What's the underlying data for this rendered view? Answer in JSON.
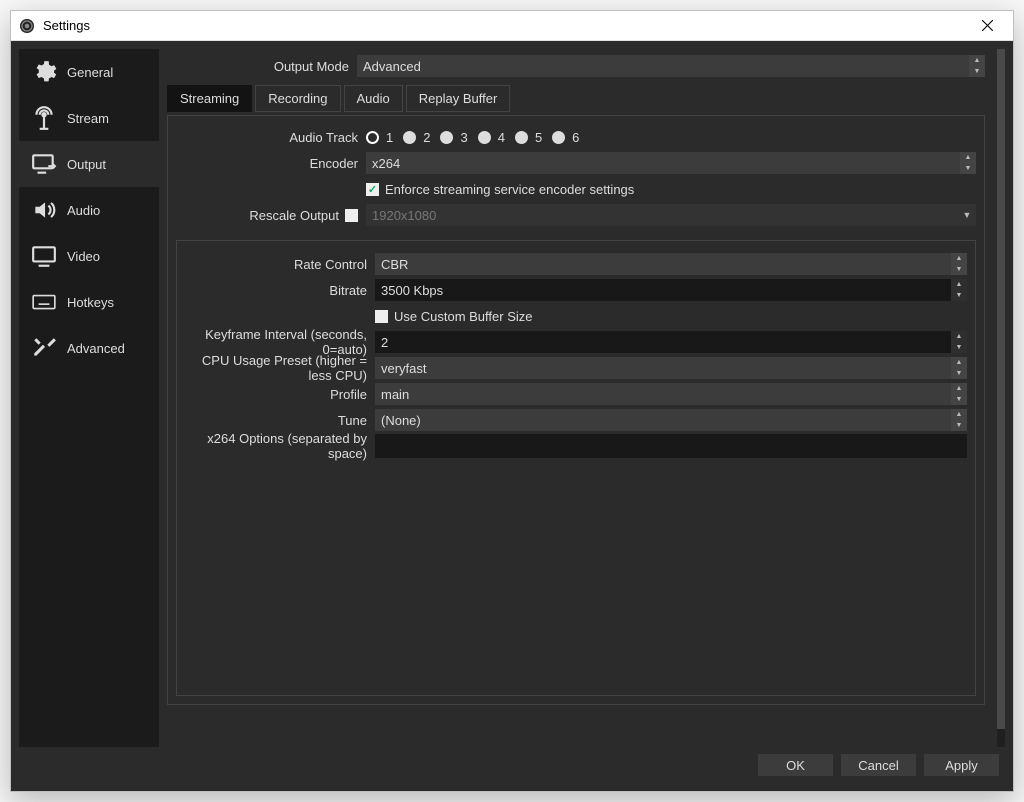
{
  "window_title": "Settings",
  "sidebar": {
    "items": [
      {
        "label": "General"
      },
      {
        "label": "Stream"
      },
      {
        "label": "Output"
      },
      {
        "label": "Audio"
      },
      {
        "label": "Video"
      },
      {
        "label": "Hotkeys"
      },
      {
        "label": "Advanced"
      }
    ],
    "active_index": 2
  },
  "output_mode": {
    "label": "Output Mode",
    "value": "Advanced"
  },
  "tabs": {
    "items": [
      {
        "label": "Streaming"
      },
      {
        "label": "Recording"
      },
      {
        "label": "Audio"
      },
      {
        "label": "Replay Buffer"
      }
    ],
    "active_index": 0
  },
  "streaming": {
    "audio_track": {
      "label": "Audio Track",
      "options": [
        "1",
        "2",
        "3",
        "4",
        "5",
        "6"
      ],
      "selected": "1"
    },
    "encoder": {
      "label": "Encoder",
      "value": "x264"
    },
    "enforce": {
      "label": "Enforce streaming service encoder settings",
      "checked": true
    },
    "rescale": {
      "label": "Rescale Output",
      "checked": false,
      "value": "1920x1080"
    },
    "rate_control": {
      "label": "Rate Control",
      "value": "CBR"
    },
    "bitrate": {
      "label": "Bitrate",
      "value": "3500 Kbps"
    },
    "use_custom_buffer": {
      "label": "Use Custom Buffer Size",
      "checked": false
    },
    "keyframe": {
      "label": "Keyframe Interval (seconds, 0=auto)",
      "value": "2"
    },
    "cpu_preset": {
      "label": "CPU Usage Preset (higher = less CPU)",
      "value": "veryfast"
    },
    "profile": {
      "label": "Profile",
      "value": "main"
    },
    "tune": {
      "label": "Tune",
      "value": "(None)"
    },
    "x264_options": {
      "label": "x264 Options (separated by space)",
      "value": ""
    }
  },
  "footer": {
    "ok": "OK",
    "cancel": "Cancel",
    "apply": "Apply"
  }
}
